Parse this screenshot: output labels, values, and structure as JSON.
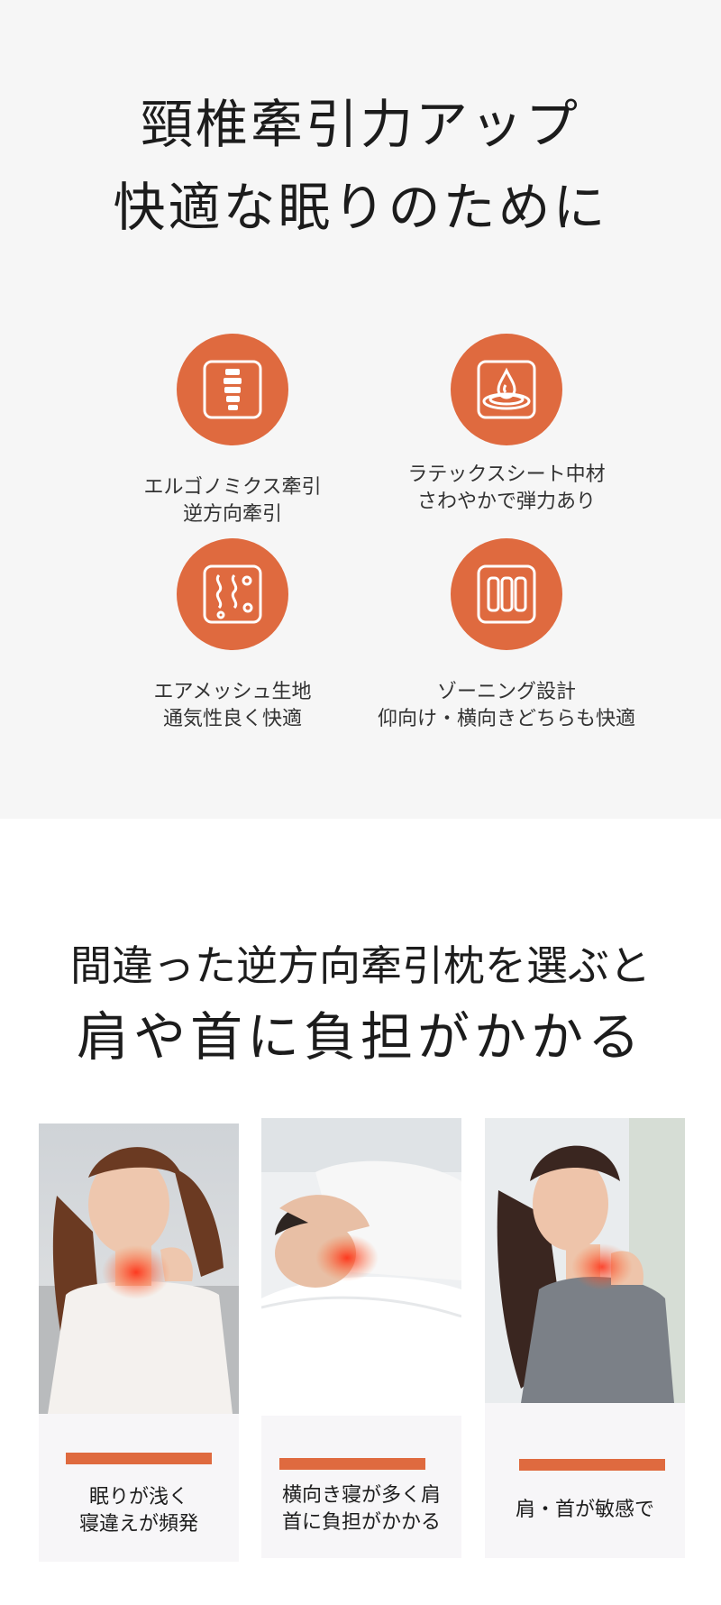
{
  "hero": {
    "line1": "頸椎牽引力アップ",
    "line2": "快適な眠りのために"
  },
  "features": [
    {
      "icon": "spine-icon",
      "line1": "エルゴノミクス牽引",
      "line2": "逆方向牽引"
    },
    {
      "icon": "water-drop-icon",
      "line1": "ラテックスシート中材",
      "line2": "さわやかで弾力あり"
    },
    {
      "icon": "air-mesh-icon",
      "line1": "エアメッシュ生地",
      "line2": "通気性良く快適"
    },
    {
      "icon": "zoning-icon",
      "line1": "ゾーニング設計",
      "line2": "仰向け・横向きどちらも快適"
    }
  ],
  "problem": {
    "line1": "間違った逆方向牽引枕を選ぶと",
    "line2": "肩や首に負担がかかる"
  },
  "cards": [
    {
      "line1": "眠りが浅く",
      "line2": "寝違えが頻発"
    },
    {
      "line1": "横向き寝が多く肩",
      "line2": "首に負担がかかる"
    },
    {
      "line1": "肩・首が敏感で",
      "line2": ""
    }
  ],
  "colors": {
    "accent": "#df6a3f",
    "section_bg": "#f6f6f6",
    "card_bg": "#f7f6f8"
  }
}
